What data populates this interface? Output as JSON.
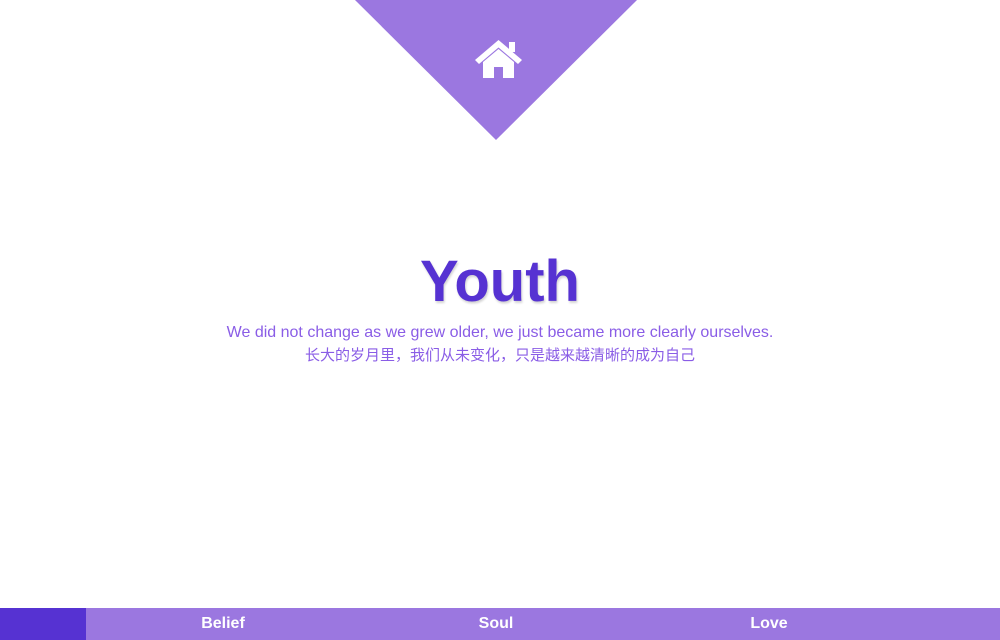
{
  "home": {
    "icon": "home-icon"
  },
  "hero": {
    "title": "Youth",
    "subtitle_en": "We did not change as we grew older, we just became more clearly ourselves.",
    "subtitle_cn": "长大的岁月里，我们从未变化，只是越来越清晰的成为自己"
  },
  "nav": {
    "items": [
      {
        "label": "Belief"
      },
      {
        "label": "Soul"
      },
      {
        "label": "Love"
      }
    ]
  },
  "colors": {
    "accent": "#5632d2",
    "accent_light": "#9b77e0",
    "subtitle": "#8a5de6",
    "background": "#ffffff"
  }
}
